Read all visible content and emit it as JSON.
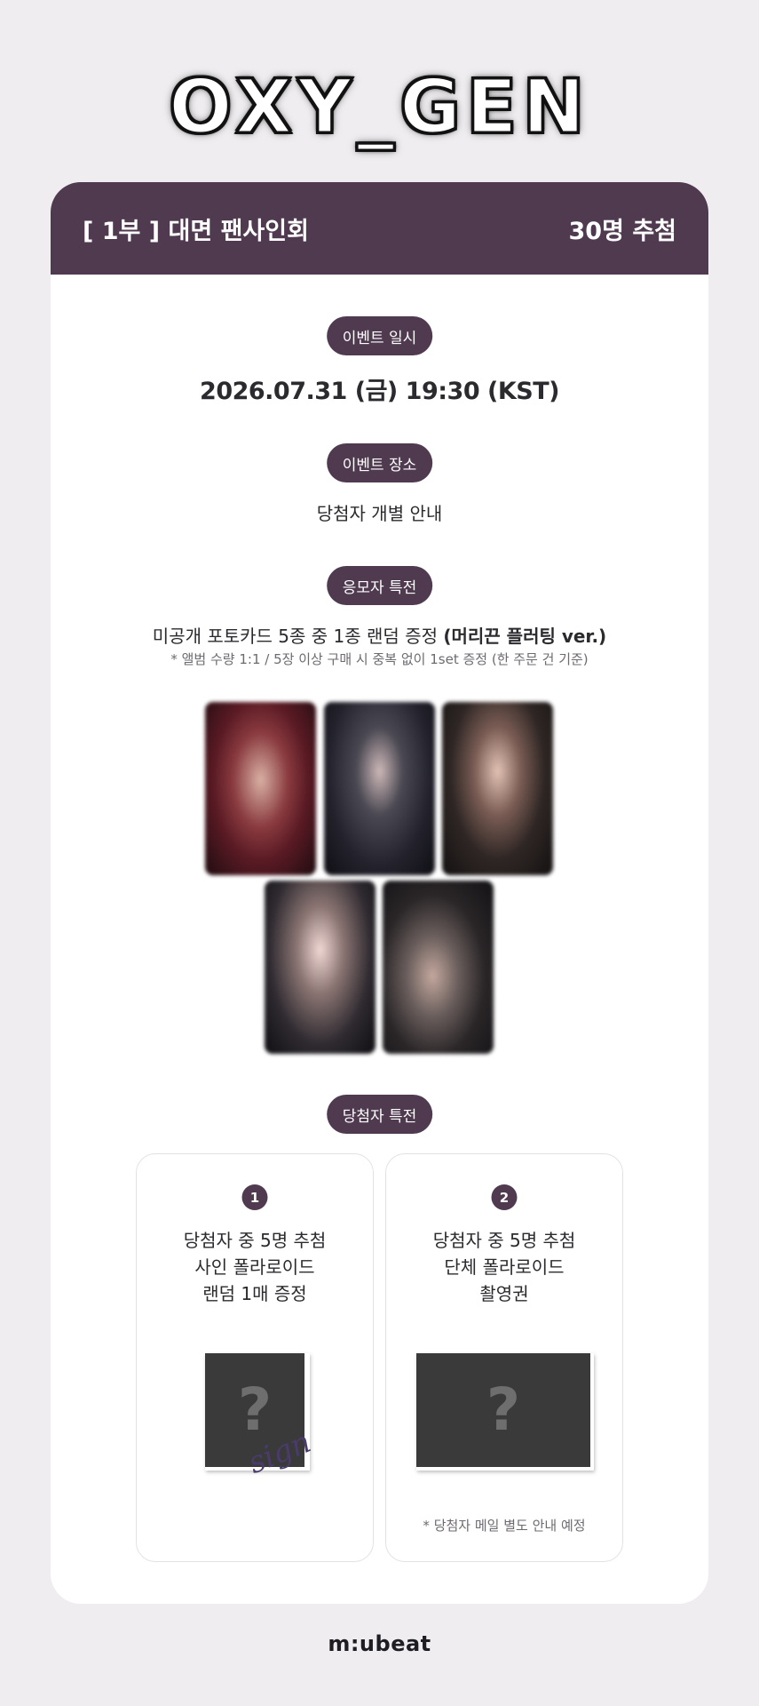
{
  "logo": {
    "text": "OXY_GEN"
  },
  "header": {
    "left": "[ 1부 ] 대면 팬사인회",
    "right": "30명 추첨"
  },
  "event_date": {
    "label": "이벤트 일시",
    "value": "2026.07.31 (금) 19:30 (KST)"
  },
  "event_place": {
    "label": "이벤트 장소",
    "value": "당첨자 개별 안내"
  },
  "entrant_benefit": {
    "label": "응모자 특전",
    "text_plain": "미공개 포토카드 5종 중 1종 랜덤 증정 ",
    "text_bold": "(머리끈 플러팅 ver.)",
    "note": "* 앨범 수량 1:1 / 5장 이상 구매 시 중복 없이 1set 증정 (한 주문 건 기준)"
  },
  "winner_benefit": {
    "label": "당첨자 특전",
    "prizes": [
      {
        "number": "1",
        "line1": "당첨자 중 5명 추첨",
        "line2": "사인 폴라로이드",
        "line3": "랜덤 1매 증정",
        "placeholder": "?",
        "sign": "sign"
      },
      {
        "number": "2",
        "line1": "당첨자 중 5명 추첨",
        "line2": "단체 폴라로이드",
        "line3": "촬영권",
        "placeholder": "?",
        "note": "* 당첨자 메일 별도 안내 예정"
      }
    ]
  },
  "footer": {
    "brand": "m:ubeat"
  },
  "colors": {
    "accent": "#4f3a50",
    "background": "#efedf0",
    "card": "#ffffff"
  }
}
